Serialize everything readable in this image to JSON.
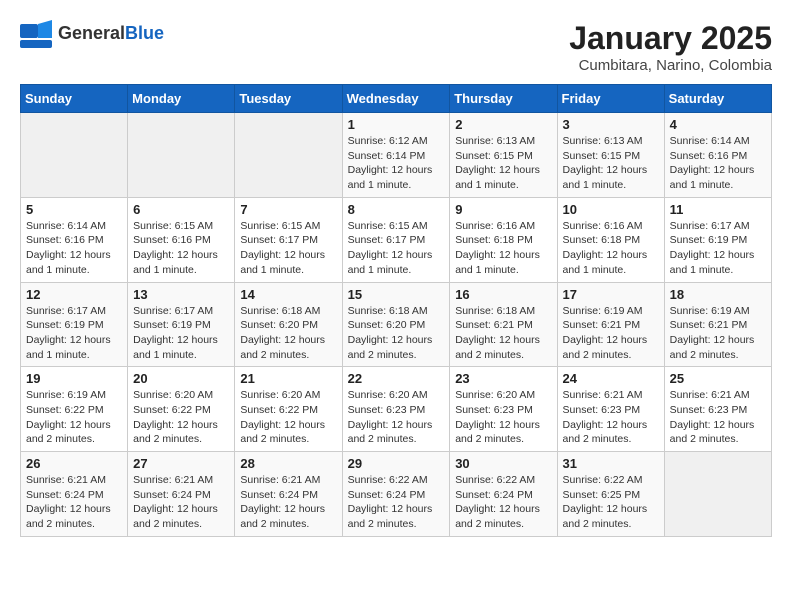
{
  "header": {
    "logo_general": "General",
    "logo_blue": "Blue",
    "month_title": "January 2025",
    "subtitle": "Cumbitara, Narino, Colombia"
  },
  "days_of_week": [
    "Sunday",
    "Monday",
    "Tuesday",
    "Wednesday",
    "Thursday",
    "Friday",
    "Saturday"
  ],
  "weeks": [
    [
      {
        "day": "",
        "info": ""
      },
      {
        "day": "",
        "info": ""
      },
      {
        "day": "",
        "info": ""
      },
      {
        "day": "1",
        "info": "Sunrise: 6:12 AM\nSunset: 6:14 PM\nDaylight: 12 hours and 1 minute."
      },
      {
        "day": "2",
        "info": "Sunrise: 6:13 AM\nSunset: 6:15 PM\nDaylight: 12 hours and 1 minute."
      },
      {
        "day": "3",
        "info": "Sunrise: 6:13 AM\nSunset: 6:15 PM\nDaylight: 12 hours and 1 minute."
      },
      {
        "day": "4",
        "info": "Sunrise: 6:14 AM\nSunset: 6:16 PM\nDaylight: 12 hours and 1 minute."
      }
    ],
    [
      {
        "day": "5",
        "info": "Sunrise: 6:14 AM\nSunset: 6:16 PM\nDaylight: 12 hours and 1 minute."
      },
      {
        "day": "6",
        "info": "Sunrise: 6:15 AM\nSunset: 6:16 PM\nDaylight: 12 hours and 1 minute."
      },
      {
        "day": "7",
        "info": "Sunrise: 6:15 AM\nSunset: 6:17 PM\nDaylight: 12 hours and 1 minute."
      },
      {
        "day": "8",
        "info": "Sunrise: 6:15 AM\nSunset: 6:17 PM\nDaylight: 12 hours and 1 minute."
      },
      {
        "day": "9",
        "info": "Sunrise: 6:16 AM\nSunset: 6:18 PM\nDaylight: 12 hours and 1 minute."
      },
      {
        "day": "10",
        "info": "Sunrise: 6:16 AM\nSunset: 6:18 PM\nDaylight: 12 hours and 1 minute."
      },
      {
        "day": "11",
        "info": "Sunrise: 6:17 AM\nSunset: 6:19 PM\nDaylight: 12 hours and 1 minute."
      }
    ],
    [
      {
        "day": "12",
        "info": "Sunrise: 6:17 AM\nSunset: 6:19 PM\nDaylight: 12 hours and 1 minute."
      },
      {
        "day": "13",
        "info": "Sunrise: 6:17 AM\nSunset: 6:19 PM\nDaylight: 12 hours and 1 minute."
      },
      {
        "day": "14",
        "info": "Sunrise: 6:18 AM\nSunset: 6:20 PM\nDaylight: 12 hours and 2 minutes."
      },
      {
        "day": "15",
        "info": "Sunrise: 6:18 AM\nSunset: 6:20 PM\nDaylight: 12 hours and 2 minutes."
      },
      {
        "day": "16",
        "info": "Sunrise: 6:18 AM\nSunset: 6:21 PM\nDaylight: 12 hours and 2 minutes."
      },
      {
        "day": "17",
        "info": "Sunrise: 6:19 AM\nSunset: 6:21 PM\nDaylight: 12 hours and 2 minutes."
      },
      {
        "day": "18",
        "info": "Sunrise: 6:19 AM\nSunset: 6:21 PM\nDaylight: 12 hours and 2 minutes."
      }
    ],
    [
      {
        "day": "19",
        "info": "Sunrise: 6:19 AM\nSunset: 6:22 PM\nDaylight: 12 hours and 2 minutes."
      },
      {
        "day": "20",
        "info": "Sunrise: 6:20 AM\nSunset: 6:22 PM\nDaylight: 12 hours and 2 minutes."
      },
      {
        "day": "21",
        "info": "Sunrise: 6:20 AM\nSunset: 6:22 PM\nDaylight: 12 hours and 2 minutes."
      },
      {
        "day": "22",
        "info": "Sunrise: 6:20 AM\nSunset: 6:23 PM\nDaylight: 12 hours and 2 minutes."
      },
      {
        "day": "23",
        "info": "Sunrise: 6:20 AM\nSunset: 6:23 PM\nDaylight: 12 hours and 2 minutes."
      },
      {
        "day": "24",
        "info": "Sunrise: 6:21 AM\nSunset: 6:23 PM\nDaylight: 12 hours and 2 minutes."
      },
      {
        "day": "25",
        "info": "Sunrise: 6:21 AM\nSunset: 6:23 PM\nDaylight: 12 hours and 2 minutes."
      }
    ],
    [
      {
        "day": "26",
        "info": "Sunrise: 6:21 AM\nSunset: 6:24 PM\nDaylight: 12 hours and 2 minutes."
      },
      {
        "day": "27",
        "info": "Sunrise: 6:21 AM\nSunset: 6:24 PM\nDaylight: 12 hours and 2 minutes."
      },
      {
        "day": "28",
        "info": "Sunrise: 6:21 AM\nSunset: 6:24 PM\nDaylight: 12 hours and 2 minutes."
      },
      {
        "day": "29",
        "info": "Sunrise: 6:22 AM\nSunset: 6:24 PM\nDaylight: 12 hours and 2 minutes."
      },
      {
        "day": "30",
        "info": "Sunrise: 6:22 AM\nSunset: 6:24 PM\nDaylight: 12 hours and 2 minutes."
      },
      {
        "day": "31",
        "info": "Sunrise: 6:22 AM\nSunset: 6:25 PM\nDaylight: 12 hours and 2 minutes."
      },
      {
        "day": "",
        "info": ""
      }
    ]
  ]
}
